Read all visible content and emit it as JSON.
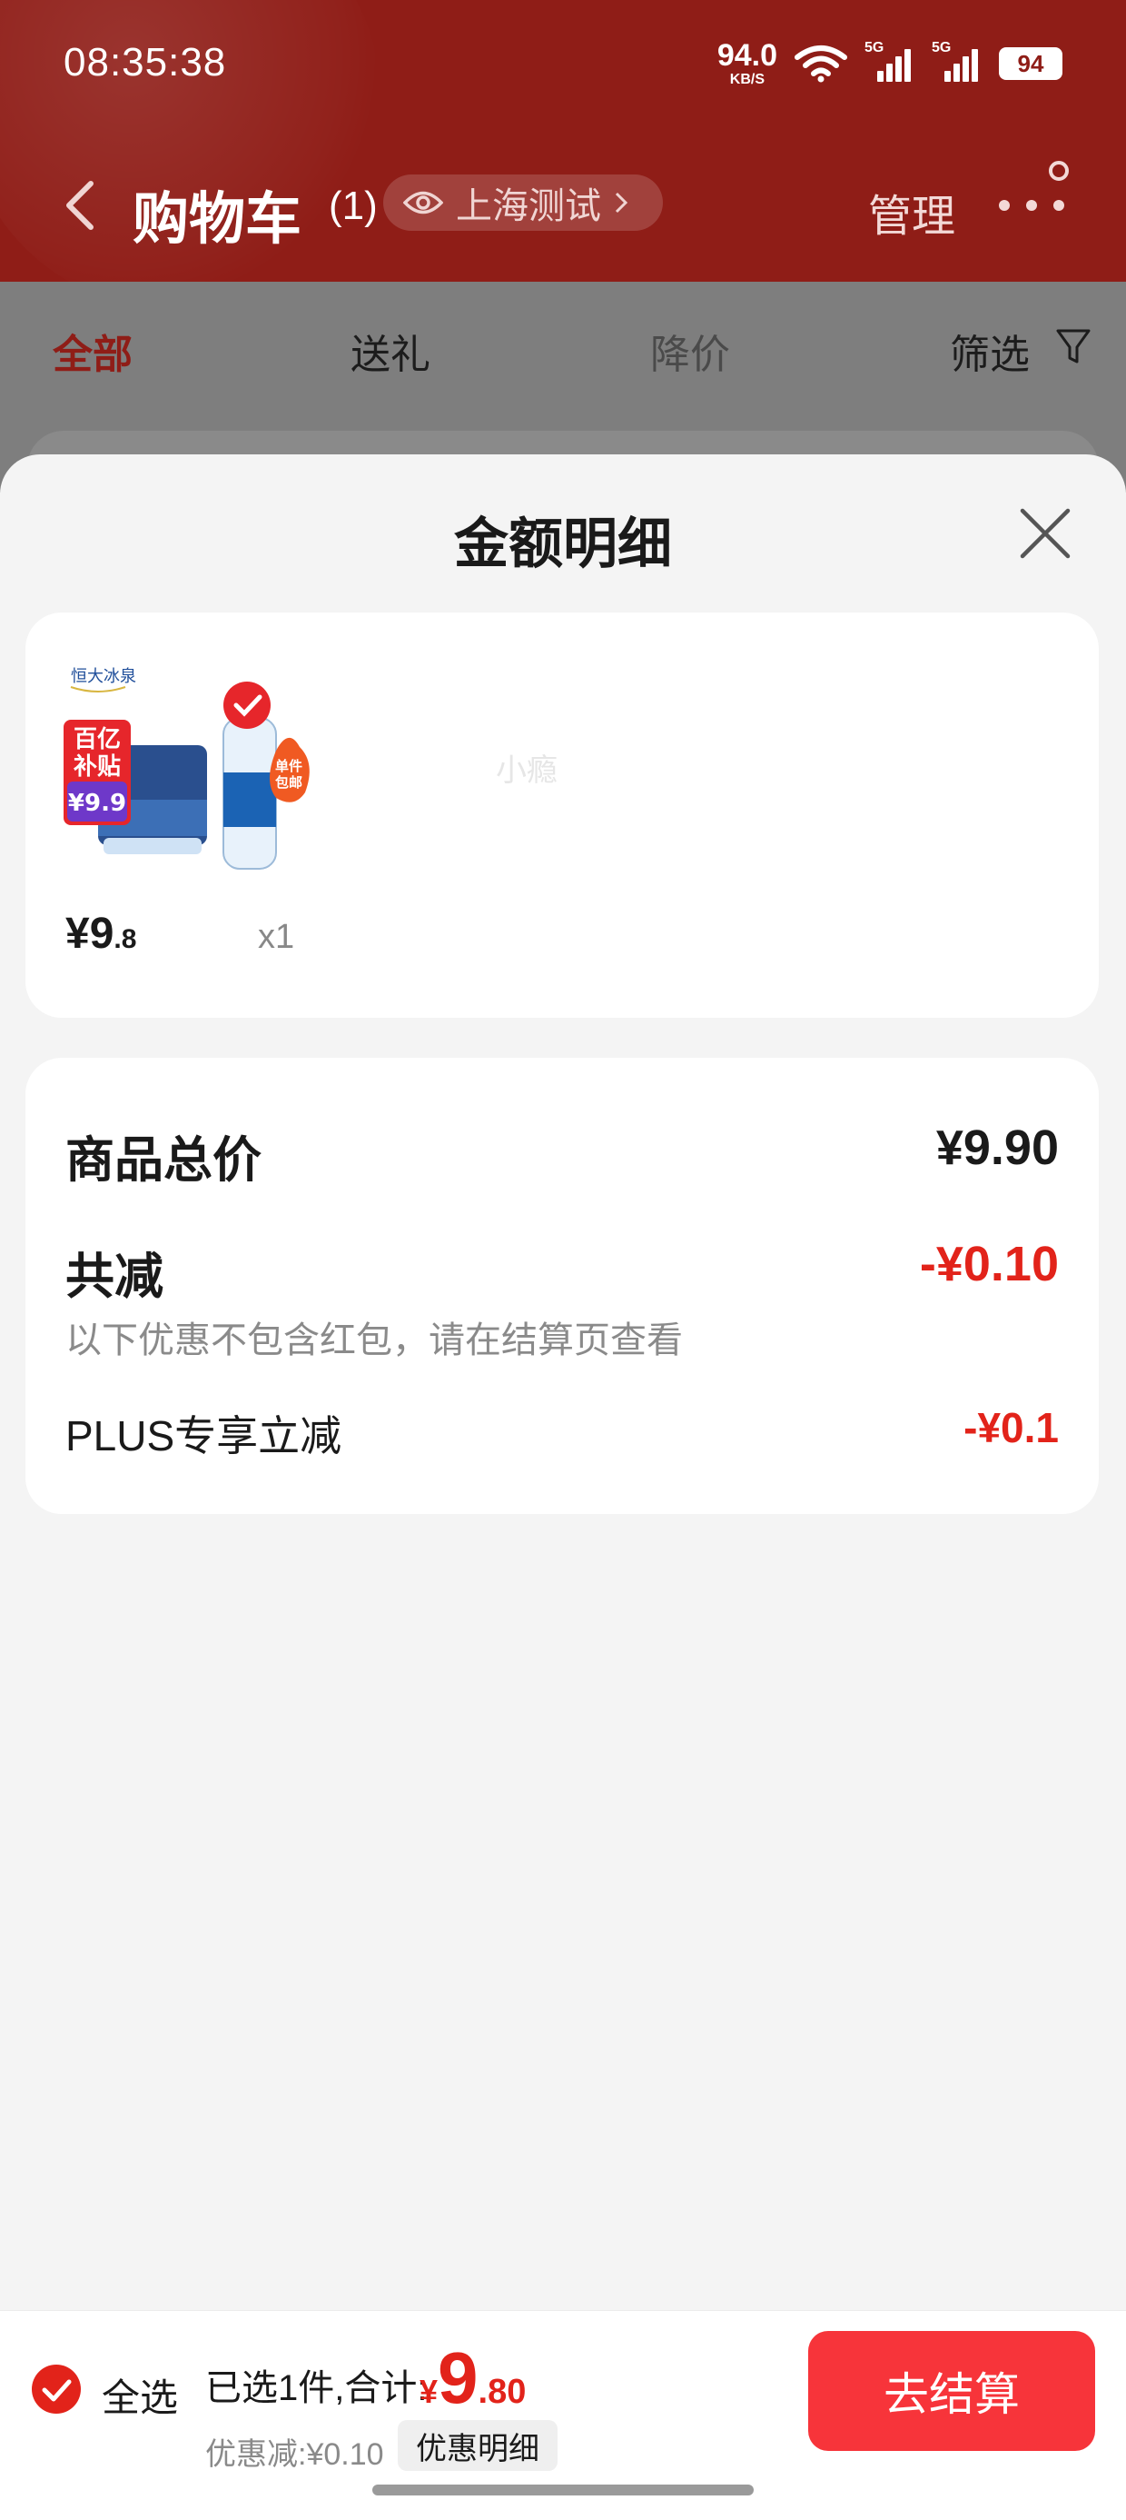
{
  "status_bar": {
    "time": "08:35:38",
    "speed_value": "94.0",
    "speed_unit": "KB/S",
    "sim1": "5G",
    "sim2": "5G",
    "battery": "94"
  },
  "nav": {
    "title": "购物车",
    "count": "(1)",
    "location": "上海测试",
    "manage": "管理"
  },
  "tabs": [
    "全部",
    "送礼",
    "降价",
    "筛选"
  ],
  "sheet": {
    "title": "金额明细",
    "product": {
      "brand": "恒大冰泉",
      "promo_badge": "百亿补贴",
      "shipping_badge": "单件包邮",
      "price_symbol": "¥",
      "price_int": "9",
      "price_dec": ".8",
      "quantity": "x1"
    },
    "summary": {
      "total_label": "商品总价",
      "total_value": "¥9.90",
      "reduce_label": "共减",
      "reduce_value": "-¥0.10",
      "note": "以下优惠不包含红包，请在结算页查看",
      "plus_label": "PLUS专享立减",
      "plus_value": "-¥0.1"
    },
    "watermark": "小瘾"
  },
  "bottom_bar": {
    "select_all": "全选",
    "selected_text": "已选1件,合计:",
    "total_currency": "¥",
    "total_int": "9",
    "total_dec": ".80",
    "discount_text": "优惠减:¥0.10",
    "detail_chip": "优惠明细",
    "checkout": "去结算"
  },
  "colors": {
    "header_red": "#8f1d17",
    "accent_red": "#e2231a",
    "button_red": "#f7343a"
  }
}
